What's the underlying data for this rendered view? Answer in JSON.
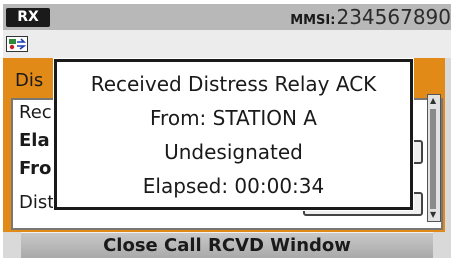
{
  "status": {
    "rx_label": "RX",
    "mmsi_label": "MMSI:",
    "mmsi_value": "234567890"
  },
  "icons": {
    "gps": "gps-icon"
  },
  "call_window": {
    "title": "Dis",
    "rows": [
      "Rec",
      "Ela",
      "Fro",
      "Distress ID"
    ],
    "accent_color": "#e28a18"
  },
  "popup": {
    "line1": "Received Distress Relay ACK",
    "line2": "From: STATION A",
    "line3": "Undesignated",
    "line4": "Elapsed: 00:00:34"
  },
  "bottom_button": {
    "label": "Close Call RCVD Window"
  }
}
